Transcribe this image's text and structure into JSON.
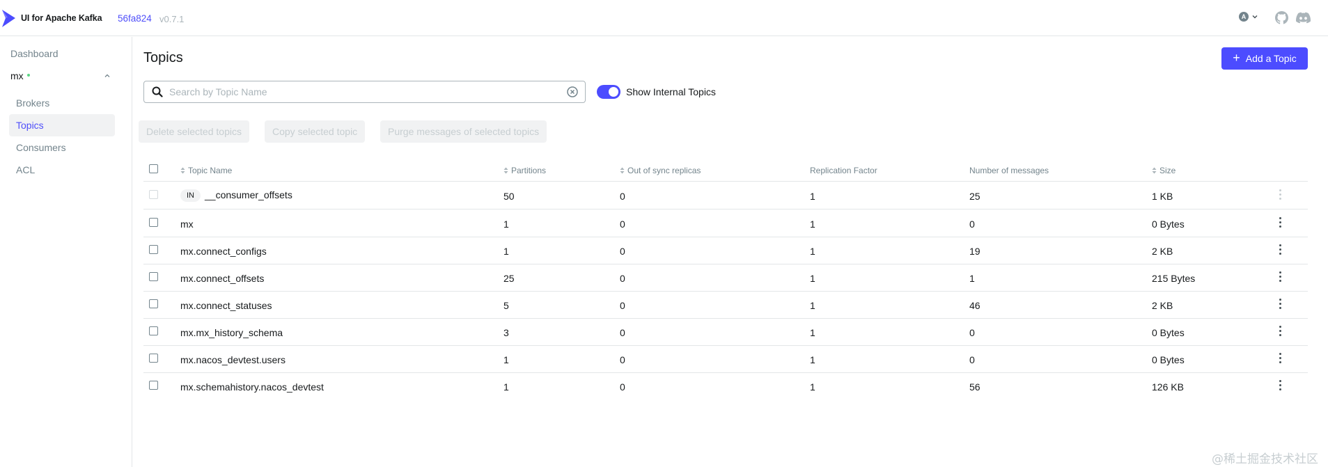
{
  "header": {
    "app_title": "UI for Apache Kafka",
    "version_hash": "56fa824",
    "version_num": "v0.7.1",
    "user_initial": "A"
  },
  "sidebar": {
    "dashboard": "Dashboard",
    "cluster_name": "mx",
    "cluster_status_color": "#5cd685",
    "items": [
      {
        "label": "Brokers",
        "active": false
      },
      {
        "label": "Topics",
        "active": true
      },
      {
        "label": "Consumers",
        "active": false
      },
      {
        "label": "ACL",
        "active": false
      }
    ]
  },
  "main": {
    "title": "Topics",
    "add_button": "Add a Topic",
    "search_placeholder": "Search by Topic Name",
    "search_value": "",
    "show_internal_label": "Show Internal Topics",
    "show_internal_on": true,
    "actions": [
      "Delete selected topics",
      "Copy selected topic",
      "Purge messages of selected topics"
    ]
  },
  "table": {
    "columns": [
      "Topic Name",
      "Partitions",
      "Out of sync replicas",
      "Replication Factor",
      "Number of messages",
      "Size"
    ],
    "rows": [
      {
        "internal": true,
        "badge": "IN",
        "name": "__consumer_offsets",
        "partitions": "50",
        "out_of_sync": "0",
        "replication": "1",
        "messages": "25",
        "size": "1 KB"
      },
      {
        "internal": false,
        "badge": "",
        "name": "mx",
        "partitions": "1",
        "out_of_sync": "0",
        "replication": "1",
        "messages": "0",
        "size": "0 Bytes"
      },
      {
        "internal": false,
        "badge": "",
        "name": "mx.connect_configs",
        "partitions": "1",
        "out_of_sync": "0",
        "replication": "1",
        "messages": "19",
        "size": "2 KB"
      },
      {
        "internal": false,
        "badge": "",
        "name": "mx.connect_offsets",
        "partitions": "25",
        "out_of_sync": "0",
        "replication": "1",
        "messages": "1",
        "size": "215 Bytes"
      },
      {
        "internal": false,
        "badge": "",
        "name": "mx.connect_statuses",
        "partitions": "5",
        "out_of_sync": "0",
        "replication": "1",
        "messages": "46",
        "size": "2 KB"
      },
      {
        "internal": false,
        "badge": "",
        "name": "mx.mx_history_schema",
        "partitions": "3",
        "out_of_sync": "0",
        "replication": "1",
        "messages": "0",
        "size": "0 Bytes"
      },
      {
        "internal": false,
        "badge": "",
        "name": "mx.nacos_devtest.users",
        "partitions": "1",
        "out_of_sync": "0",
        "replication": "1",
        "messages": "0",
        "size": "0 Bytes"
      },
      {
        "internal": false,
        "badge": "",
        "name": "mx.schemahistory.nacos_devtest",
        "partitions": "1",
        "out_of_sync": "0",
        "replication": "1",
        "messages": "56",
        "size": "126 KB"
      }
    ]
  },
  "watermark": "@稀土掘金技术社区",
  "colors": {
    "accent": "#4c4cff",
    "link": "#4f4ffa",
    "muted_text": "#73848c",
    "border": "#e3e6e8"
  }
}
